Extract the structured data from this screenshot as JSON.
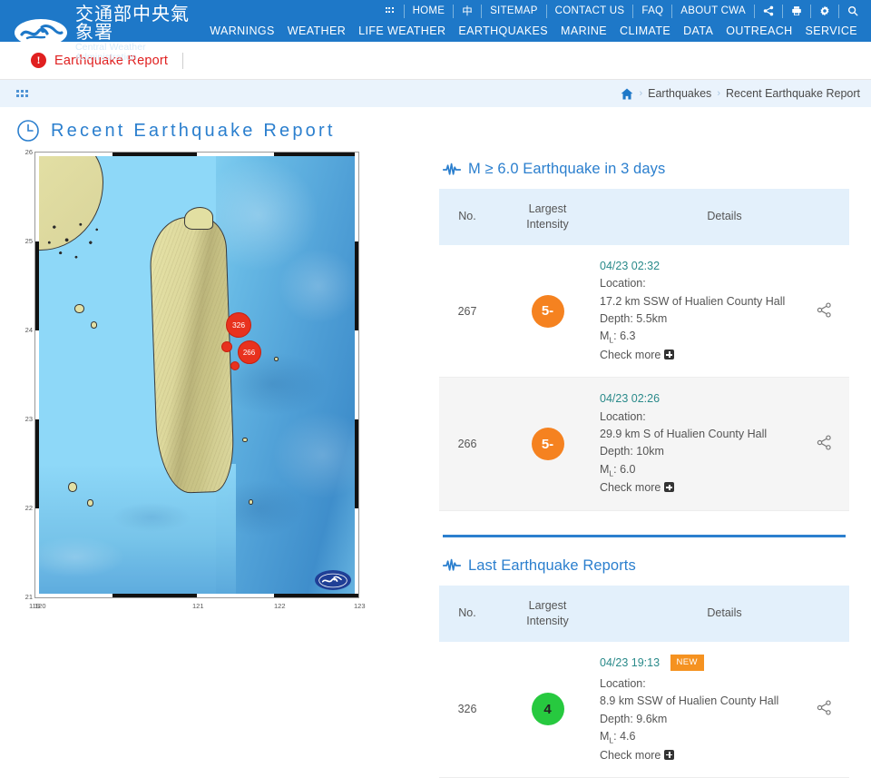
{
  "site": {
    "name_cn": "交通部中央氣象署",
    "name_en": "Central Weather Administration",
    "logo_icon": "cwa-wave-logo"
  },
  "top_nav": {
    "grid_icon": "apps-grid-icon",
    "items": [
      "HOME",
      "中",
      "SITEMAP",
      "CONTACT US",
      "FAQ",
      "ABOUT CWA"
    ],
    "icons": [
      "share-icon",
      "print-icon",
      "gear-icon",
      "search-icon"
    ]
  },
  "main_nav": {
    "items": [
      "WARNINGS",
      "WEATHER",
      "LIFE WEATHER",
      "EARTHQUAKES",
      "MARINE",
      "CLIMATE",
      "DATA",
      "OUTREACH",
      "SERVICE"
    ]
  },
  "subbar": {
    "alert_icon": "alert-exclamation-icon",
    "label": "Earthquake Report"
  },
  "breadcrumb": {
    "menu_icon": "dot-grid-icon",
    "home_icon": "home-icon",
    "items": [
      "Earthquakes",
      "Recent Earthquake Report"
    ],
    "separator": "›"
  },
  "page": {
    "clock_icon": "clock-icon",
    "title": "Recent Earthquake Report"
  },
  "map": {
    "x_ticks": [
      "119",
      "120",
      "121",
      "122",
      "123"
    ],
    "y_ticks": [
      "26",
      "25",
      "24",
      "23",
      "22",
      "21"
    ],
    "markers": [
      {
        "label": "326"
      },
      {
        "label": "266"
      }
    ],
    "watermark_icon": "cwa-wave-logo"
  },
  "sections": [
    {
      "icon": "seismograph-pulse-icon",
      "title": "M ≥ 6.0 Earthquake in 3 days",
      "columns": [
        "No.",
        "Largest Intensity",
        "Details"
      ],
      "rows": [
        {
          "no": "267",
          "intensity": "5-",
          "intensity_color": "#f58220",
          "datetime": "04/23 02:32",
          "is_new": false,
          "location_label": "Location:",
          "location": "17.2 km SSW of Hualien County Hall",
          "depth": "Depth: 5.5km",
          "magnitude": "6.3",
          "magnitude_label": "M",
          "magnitude_sub": "L",
          "check_more": "Check more",
          "share_icon": "share-icon"
        },
        {
          "no": "266",
          "intensity": "5-",
          "intensity_color": "#f58220",
          "datetime": "04/23 02:26",
          "is_new": false,
          "location_label": "Location:",
          "location": "29.9 km S of Hualien County Hall",
          "depth": "Depth: 10km",
          "magnitude": "6.0",
          "magnitude_label": "M",
          "magnitude_sub": "L",
          "check_more": "Check more",
          "share_icon": "share-icon"
        }
      ]
    },
    {
      "icon": "seismograph-pulse-icon",
      "title": "Last Earthquake Reports",
      "columns": [
        "No.",
        "Largest Intensity",
        "Details"
      ],
      "rows": [
        {
          "no": "326",
          "intensity": "4",
          "intensity_color": "#27c93f",
          "datetime": "04/23 19:13",
          "is_new": true,
          "new_label": "NEW",
          "location_label": "Location:",
          "location": "8.9 km SSW of Hualien County Hall",
          "depth": "Depth: 9.6km",
          "magnitude": "4.6",
          "magnitude_label": "M",
          "magnitude_sub": "L",
          "check_more": "Check more",
          "share_icon": "share-icon"
        }
      ]
    }
  ],
  "colors": {
    "brand_blue": "#1e78c8",
    "alert_red": "#e02020",
    "accent_teal": "#2a8a8a",
    "new_orange": "#f59220",
    "header_row": "#e3f0fb"
  }
}
